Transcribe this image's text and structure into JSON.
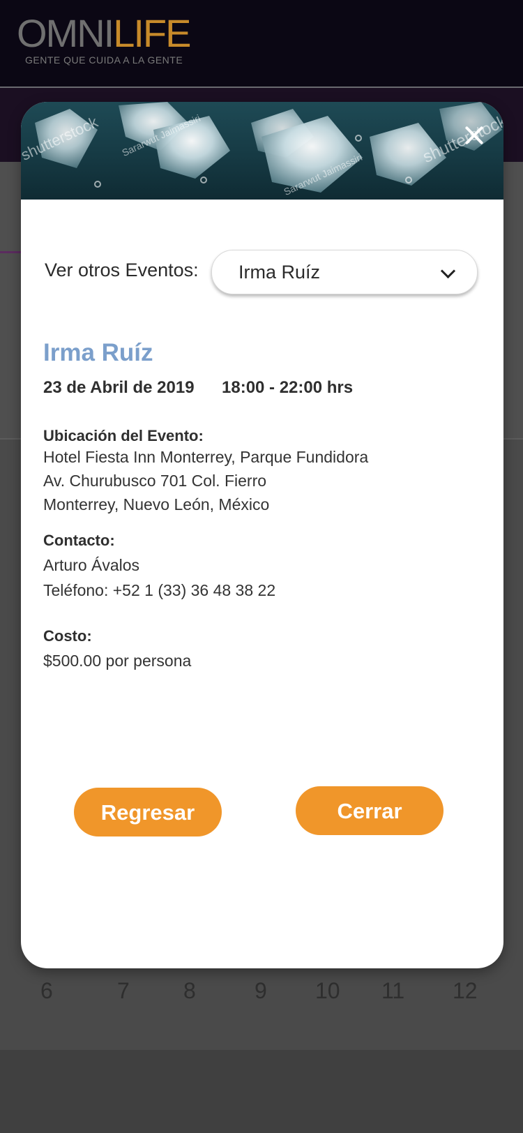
{
  "brand": {
    "name_part1": "OMNI",
    "name_part2": "LIFE",
    "tagline": "GENTE QUE CUIDA A LA GENTE"
  },
  "calendar": {
    "visible_days": [
      "6",
      "7",
      "8",
      "9",
      "10",
      "11",
      "12"
    ]
  },
  "modal": {
    "hero_watermarks": [
      "shutterstock",
      "Sararwut Jaimassiri",
      "Sararwut Jaimassiri",
      "shutterstock"
    ],
    "filter": {
      "label": "Ver otros Eventos:",
      "selected": "Irma Ruíz"
    },
    "event": {
      "title": "Irma Ruíz",
      "date": "23 de Abril de 2019",
      "time": "18:00 - 22:00 hrs",
      "location_label": "Ubicación del Evento:",
      "location_lines": [
        "Hotel Fiesta Inn Monterrey, Parque Fundidora",
        "Av. Churubusco 701 Col. Fierro",
        "Monterrey, Nuevo León, México"
      ],
      "contact_label": "Contacto:",
      "contact_name": "Arturo Ávalos",
      "contact_phone": "Teléfono: +52 1 (33) 36 48 38 22",
      "cost_label": "Costo:",
      "cost_value": "$500.00 por persona"
    },
    "buttons": {
      "back": "Regresar",
      "close": "Cerrar"
    }
  },
  "colors": {
    "accent_orange": "#f0962a",
    "title_blue": "#7b9fcb",
    "header_dark": "#0b0714",
    "overlay_gray": "#4a4a4a"
  },
  "icons": {
    "close": "close-icon",
    "dropdown": "chevron-down-icon"
  }
}
